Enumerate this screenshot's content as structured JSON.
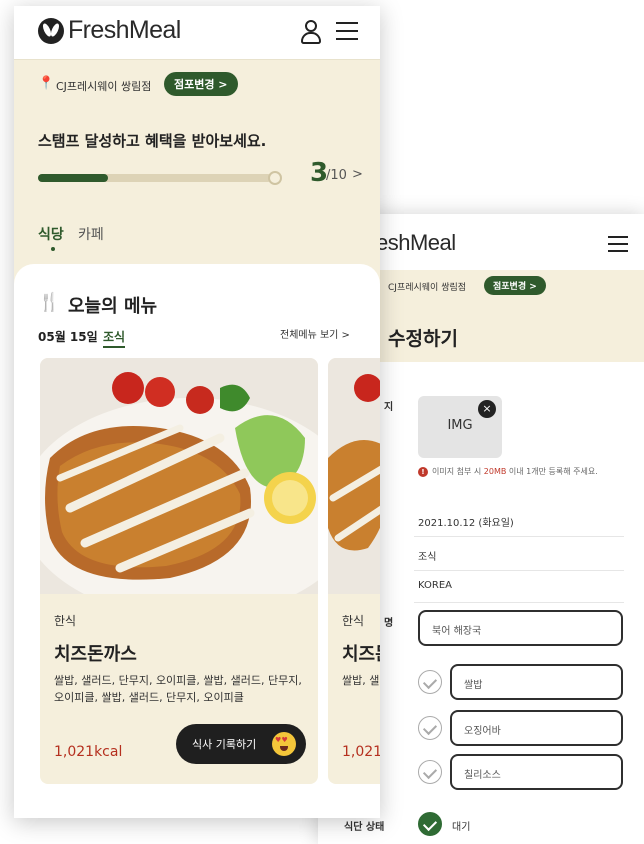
{
  "colors": {
    "brand_green": "#2f5a2c",
    "cream": "#f5efdc",
    "calorie_red": "#b5301f"
  },
  "front": {
    "logo": "FreshMeal",
    "icons": [
      "leaf-logo-icon",
      "user-icon",
      "hamburger-menu-icon",
      "location-pin-icon",
      "fork-knife-icon",
      "heart-eyes-emoji-icon"
    ],
    "location": "CJ프레시웨이 쌍림점",
    "change_store": "점포변경 >",
    "stamp_message": "스탬프 달성하고 혜택을 받아보세요.",
    "stamp": {
      "current": "3",
      "total": "/10",
      "arrow": ">",
      "progress_fraction": 0.3
    },
    "tabs": [
      {
        "label": "식당",
        "active": true
      },
      {
        "label": "카페",
        "active": false
      }
    ],
    "today_menu_title": "오늘의 메뉴",
    "date": "05월 15일",
    "meal_type": "조식",
    "view_all": "전체메뉴 보기 >",
    "cards": [
      {
        "category": "한식",
        "name": "치즈돈까스",
        "description": "쌀밥, 샐러드, 단무지, 오이피클, 쌀밥, 샐러드, 단무지, 오이피클, 쌀밥, 샐러드, 단무지, 오이피클",
        "kcal": "1,021kcal",
        "record_button": "식사 기록하기"
      },
      {
        "category": "한식",
        "name": "치즈돈",
        "description": "쌀밥, 샐",
        "kcal": "1,021k"
      }
    ]
  },
  "back": {
    "logo": "eshMeal",
    "location": "CJ프레시웨이 쌍림점",
    "change_store": "점포변경 >",
    "title": "수정하기",
    "image_label": "지",
    "image_placeholder": "IMG",
    "remove_icon": "×",
    "warning": {
      "prefix": "이미지 첨부 시 ",
      "highlight": "20MB",
      "suffix": " 이내 1개만 등록해 주세요."
    },
    "date": "2021.10.12 (화요일)",
    "meal": "조식",
    "corner": "KOREA",
    "menu_label": "명",
    "menu_name": "북어 해장국",
    "side_dishes": [
      "쌀밥",
      "오징어바",
      "칠리소스"
    ],
    "status_label": "식단 상태",
    "status_value": "대기"
  }
}
